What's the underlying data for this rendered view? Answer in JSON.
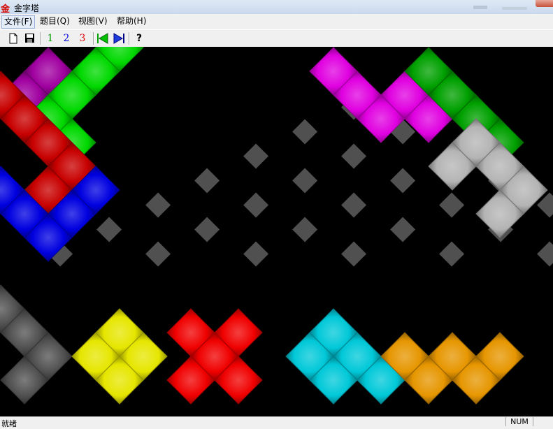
{
  "window": {
    "title": "金字塔",
    "icon_glyph": "金"
  },
  "menu": {
    "items": [
      "文件(F)",
      "题目(Q)",
      "视图(V)",
      "帮助(H)"
    ]
  },
  "toolbar": {
    "new_icon": "new-document-icon",
    "save_icon": "save-icon",
    "level1_label": "1",
    "level1_color": "#00a000",
    "level2_label": "2",
    "level2_color": "#0000e0",
    "level3_label": "3",
    "level3_color": "#e00000",
    "first_icon": "first-arrow-icon",
    "last_icon": "last-arrow-icon",
    "help_label": "?"
  },
  "statusbar": {
    "text": "就绪",
    "num_indicator": "NUM"
  },
  "board": {
    "background": "#000000",
    "grid_rows": [
      [
        6,
        6
      ],
      [
        5,
        7
      ],
      [
        4,
        8
      ],
      [
        3,
        9
      ],
      [
        2,
        10
      ],
      [
        1,
        11
      ],
      [
        0,
        12
      ]
    ],
    "grid_color": "#505050",
    "pieces": [
      {
        "name": "purple-piece",
        "color": "#a000a0",
        "cells": [
          [
            0,
            1
          ],
          [
            1,
            0
          ],
          [
            1,
            2
          ],
          [
            2,
            1
          ]
        ]
      },
      {
        "name": "green-piece",
        "color": "#00d800",
        "cells": [
          [
            -1,
            4
          ],
          [
            0,
            3
          ],
          [
            1,
            2
          ],
          [
            2,
            1
          ],
          [
            3,
            2
          ]
        ]
      },
      {
        "name": "red-piece",
        "color": "#c80000",
        "cells": [
          [
            1,
            -1
          ],
          [
            2,
            0
          ],
          [
            3,
            1
          ],
          [
            4,
            2
          ],
          [
            5,
            1
          ]
        ]
      },
      {
        "name": "blue-piece",
        "color": "#0000e0",
        "cells": [
          [
            5,
            -1
          ],
          [
            6,
            0
          ],
          [
            7,
            1
          ],
          [
            6,
            2
          ],
          [
            5,
            3
          ]
        ]
      },
      {
        "name": "magenta-piece",
        "color": "#e000e0",
        "cells": [
          [
            0,
            13
          ],
          [
            1,
            14
          ],
          [
            2,
            15
          ],
          [
            1,
            16
          ],
          [
            2,
            17
          ]
        ]
      },
      {
        "name": "dark-green-piece",
        "color": "#00a000",
        "cells": [
          [
            0,
            17
          ],
          [
            1,
            18
          ],
          [
            2,
            19
          ],
          [
            3,
            20
          ]
        ]
      },
      {
        "name": "silver-piece",
        "color": "#b4b4b4",
        "cells": [
          [
            4,
            18
          ],
          [
            3,
            19
          ],
          [
            4,
            20
          ],
          [
            5,
            21
          ],
          [
            6,
            20
          ]
        ]
      },
      {
        "name": "gray-piece",
        "color": "#505050",
        "cells": [
          [
            10,
            -1
          ],
          [
            11,
            0
          ],
          [
            12,
            1
          ],
          [
            13,
            0
          ]
        ]
      },
      {
        "name": "yellow-piece",
        "color": "#e6e600",
        "cells": [
          [
            12,
            3
          ],
          [
            11,
            4
          ],
          [
            12,
            5
          ],
          [
            13,
            4
          ]
        ]
      },
      {
        "name": "bright-red-piece",
        "color": "#f00000",
        "cells": [
          [
            11,
            7
          ],
          [
            12,
            8
          ],
          [
            11,
            9
          ],
          [
            13,
            7
          ],
          [
            13,
            9
          ]
        ]
      },
      {
        "name": "cyan-piece",
        "color": "#00c8d8",
        "cells": [
          [
            11,
            13
          ],
          [
            12,
            12
          ],
          [
            12,
            14
          ],
          [
            13,
            13
          ],
          [
            13,
            15
          ]
        ]
      },
      {
        "name": "orange-piece",
        "color": "#e69600",
        "cells": [
          [
            12,
            16
          ],
          [
            13,
            17
          ],
          [
            12,
            18
          ],
          [
            13,
            19
          ],
          [
            12,
            20
          ]
        ]
      }
    ]
  }
}
